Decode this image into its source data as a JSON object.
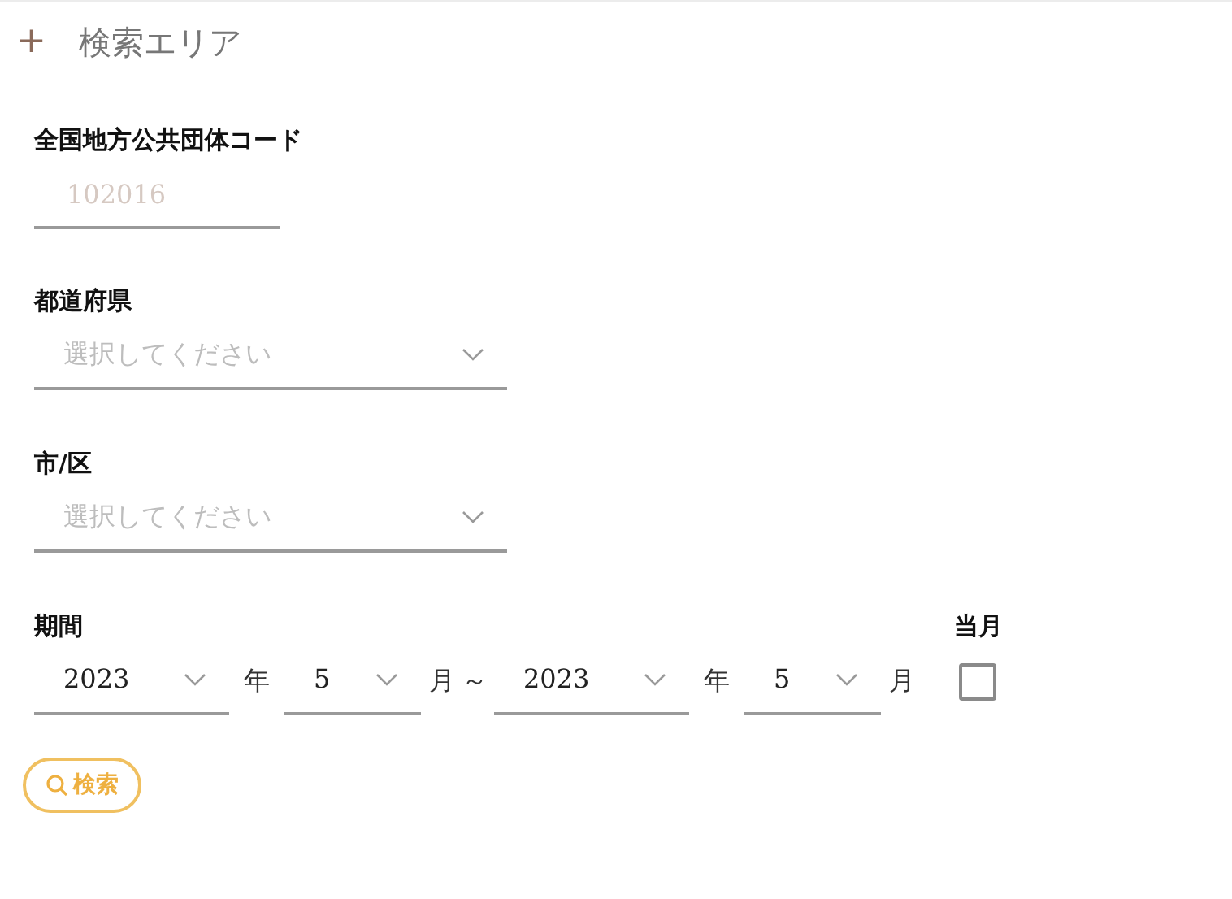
{
  "section": {
    "expand_icon": "+",
    "title": "検索エリア"
  },
  "code_field": {
    "label": "全国地方公共団体コード",
    "placeholder": "102016"
  },
  "prefecture": {
    "label": "都道府県",
    "placeholder": "選択してください"
  },
  "city": {
    "label": "市/区",
    "placeholder": "選択してください"
  },
  "period": {
    "label": "期間",
    "from_year": "2023",
    "year_unit_1": "年",
    "from_month": "5",
    "month_unit_1": "月",
    "separator": "～",
    "to_year": "2023",
    "year_unit_2": "年",
    "to_month": "5",
    "month_unit_2": "月"
  },
  "current_month": {
    "label": "当月",
    "checked": false
  },
  "search_button": {
    "label": "検索"
  }
}
